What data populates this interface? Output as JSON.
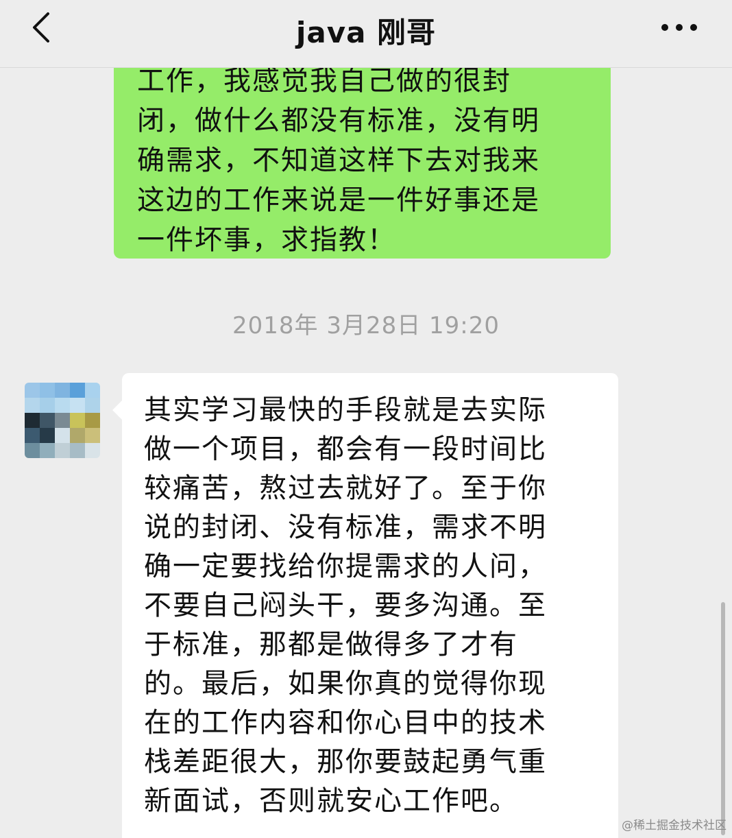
{
  "header": {
    "title": "java 刚哥",
    "back_icon": "chevron-left-icon",
    "more_icon": "more-dots-icon"
  },
  "messages": {
    "outgoing": {
      "lines": [
        "工作，我感觉我自己做的很封",
        "闭，做什么都没有标准，没有明",
        "确需求，不知道这样下去对我来",
        "这边的工作来说是一件好事还是",
        "一件坏事，求指教！"
      ]
    },
    "timestamp": "2018年 3月28日 19:20",
    "incoming": {
      "lines": [
        "其实学习最快的手段就是去实际",
        "做一个项目，都会有一段时间比",
        "较痛苦，熬过去就好了。至于你",
        "说的封闭、没有标准，需求不明",
        "确一定要找给你提需求的人问，",
        "不要自己闷头干，要多沟通。至",
        "于标准，那都是做得多了才有",
        "的。最后，如果你真的觉得你现",
        "在的工作内容和你心目中的技术",
        "栈差距很大，那你要鼓起勇气重",
        "新面试，否则就安心工作吧。"
      ]
    }
  },
  "watermark": "@稀土掘金技术社区",
  "colors": {
    "background": "#ededed",
    "outgoing_bubble": "#95ec69",
    "incoming_bubble": "#ffffff",
    "timestamp": "#a0a0a0"
  }
}
